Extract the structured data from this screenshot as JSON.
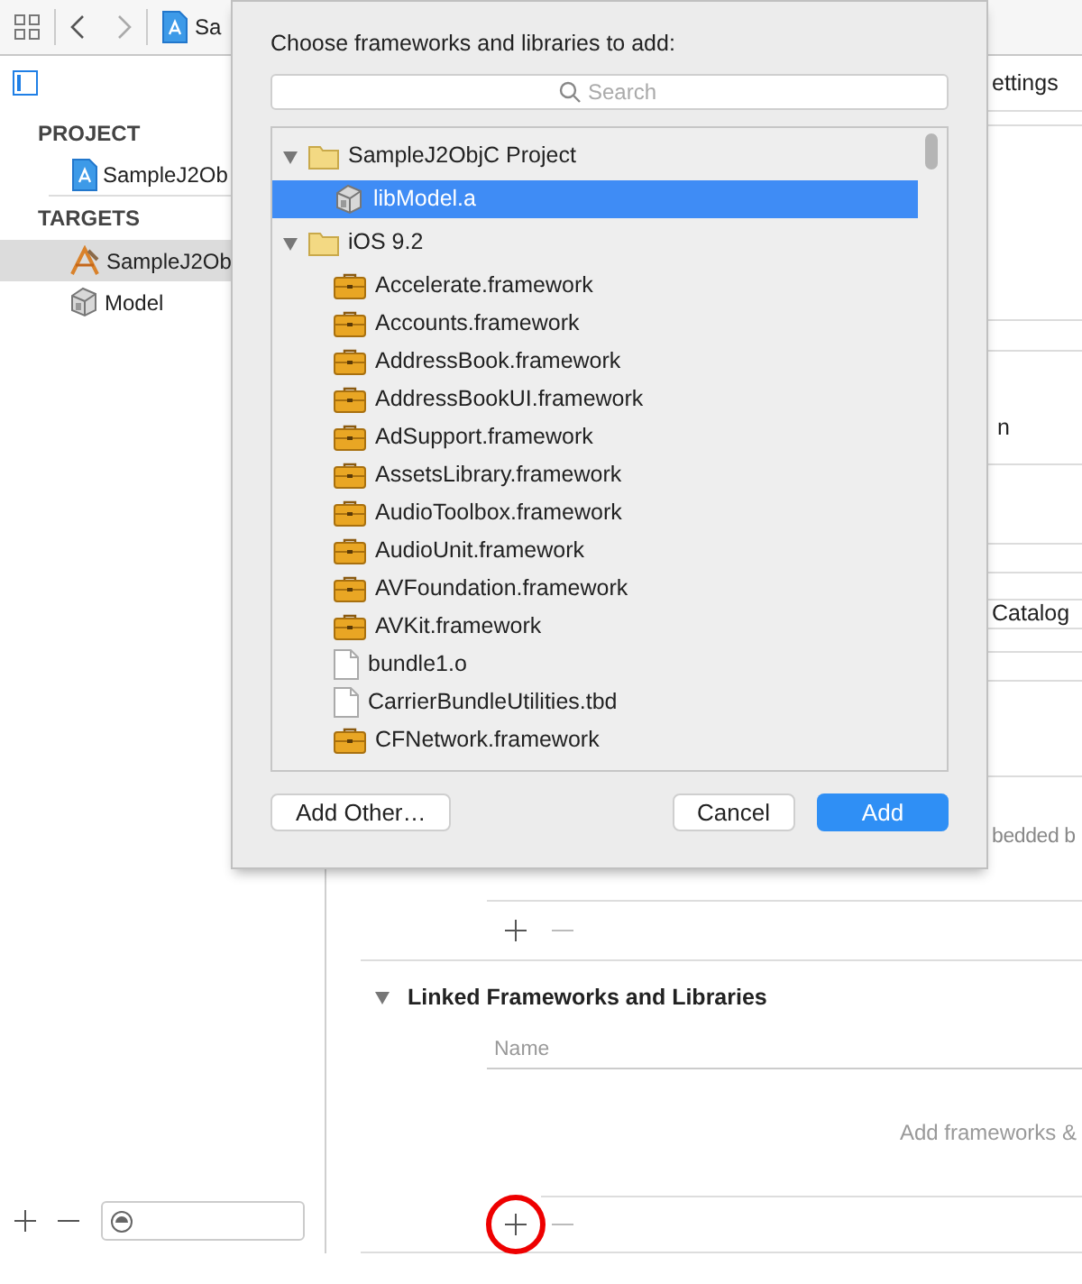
{
  "toolbar": {
    "title": "Sa"
  },
  "sidebar": {
    "sections": [
      {
        "header": "PROJECT",
        "items": [
          {
            "label": "SampleJ2Ob",
            "kind": "project",
            "selected": false
          }
        ]
      },
      {
        "header": "TARGETS",
        "items": [
          {
            "label": "SampleJ2Ob",
            "kind": "app",
            "selected": true
          },
          {
            "label": "Model",
            "kind": "library",
            "selected": false
          }
        ]
      }
    ]
  },
  "editor": {
    "tab_fragment": "ettings",
    "fragments": [
      "n",
      "Catalog"
    ],
    "embedded_hint": "bedded b",
    "linked_section": {
      "title": "Linked Frameworks and Libraries",
      "expanded": true,
      "column": "Name",
      "empty_hint": "Add frameworks &",
      "add_circled": true
    }
  },
  "dialog": {
    "title": "Choose frameworks and libraries to add:",
    "search": {
      "placeholder": "Search"
    },
    "tree": [
      {
        "label": "SampleJ2ObjC Project",
        "kind": "folder",
        "expanded": true,
        "selected": false,
        "children": [
          {
            "label": "libModel.a",
            "kind": "library",
            "selected": true
          }
        ]
      },
      {
        "label": "iOS 9.2",
        "kind": "folder",
        "expanded": true,
        "selected": false,
        "children": [
          {
            "label": "Accelerate.framework",
            "kind": "framework",
            "selected": false
          },
          {
            "label": "Accounts.framework",
            "kind": "framework",
            "selected": false
          },
          {
            "label": "AddressBook.framework",
            "kind": "framework",
            "selected": false
          },
          {
            "label": "AddressBookUI.framework",
            "kind": "framework",
            "selected": false
          },
          {
            "label": "AdSupport.framework",
            "kind": "framework",
            "selected": false
          },
          {
            "label": "AssetsLibrary.framework",
            "kind": "framework",
            "selected": false
          },
          {
            "label": "AudioToolbox.framework",
            "kind": "framework",
            "selected": false
          },
          {
            "label": "AudioUnit.framework",
            "kind": "framework",
            "selected": false
          },
          {
            "label": "AVFoundation.framework",
            "kind": "framework",
            "selected": false
          },
          {
            "label": "AVKit.framework",
            "kind": "framework",
            "selected": false
          },
          {
            "label": "bundle1.o",
            "kind": "file",
            "selected": false
          },
          {
            "label": "CarrierBundleUtilities.tbd",
            "kind": "file",
            "selected": false
          },
          {
            "label": "CFNetwork.framework",
            "kind": "framework",
            "selected": false
          }
        ]
      }
    ],
    "buttons": [
      {
        "label": "Add Other…",
        "kind": "default"
      },
      {
        "label": "Cancel",
        "kind": "default"
      },
      {
        "label": "Add",
        "kind": "primary"
      }
    ]
  }
}
